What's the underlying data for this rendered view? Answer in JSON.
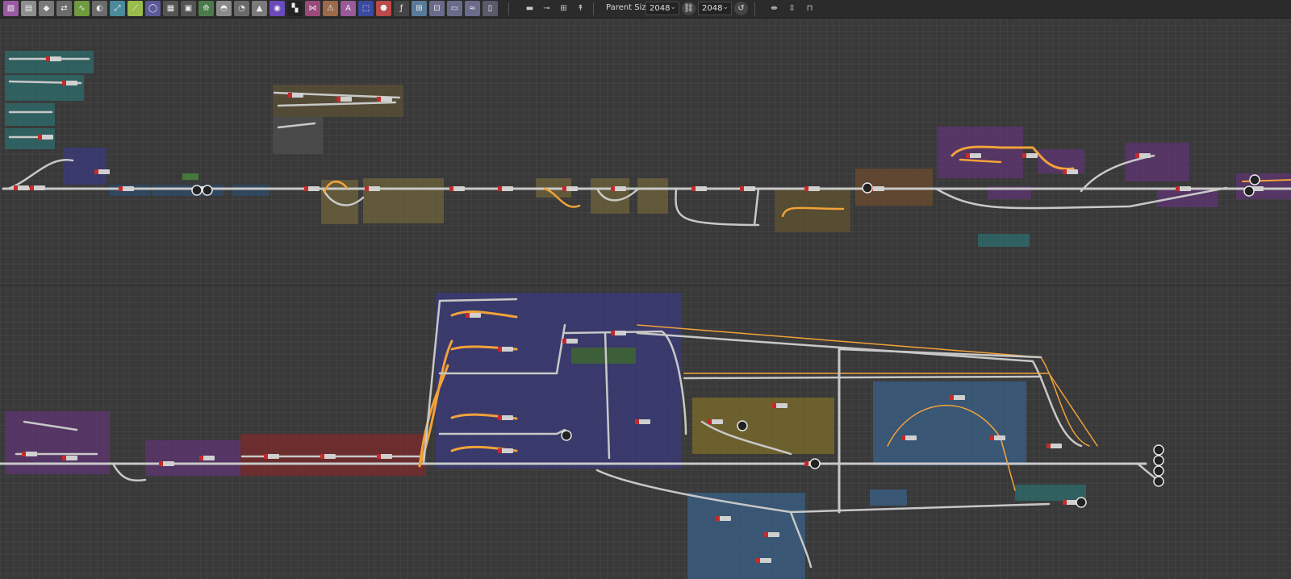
{
  "toolbar": {
    "tools": [
      {
        "name": "image-input-icon",
        "glyph": "▨",
        "color": "#9a5aa2"
      },
      {
        "name": "image-output-icon",
        "glyph": "▤",
        "color": "#8e8e8e"
      },
      {
        "name": "color-fill-icon",
        "glyph": "◆",
        "color": "#7a7a7a"
      },
      {
        "name": "shuffle-icon",
        "glyph": "⇄",
        "color": "#6b6b6b"
      },
      {
        "name": "curve-icon",
        "glyph": "∿",
        "color": "#6f9a3f"
      },
      {
        "name": "blend-icon",
        "glyph": "◐",
        "color": "#6b6b6b"
      },
      {
        "name": "transform-icon",
        "glyph": "⤢",
        "color": "#4a8a9a"
      },
      {
        "name": "levels-icon",
        "glyph": "⟋",
        "color": "#9abc4a"
      },
      {
        "name": "shape-icon",
        "glyph": "◯",
        "color": "#5a5a9a"
      },
      {
        "name": "tile-grid-icon",
        "glyph": "▦",
        "color": "#555555"
      },
      {
        "name": "bitmap-icon",
        "glyph": "▣",
        "color": "#555555"
      },
      {
        "name": "warp-icon",
        "glyph": "⟰",
        "color": "#4a7a4a"
      },
      {
        "name": "gradient-icon",
        "glyph": "◓",
        "color": "#8a8a8a"
      },
      {
        "name": "sharpen-icon",
        "glyph": "◔",
        "color": "#6a6a6a"
      },
      {
        "name": "histogram-icon",
        "glyph": "▲",
        "color": "#7a7a7a"
      },
      {
        "name": "color-wheel-icon",
        "glyph": "◉",
        "color": "#6a4aba"
      },
      {
        "name": "noise-icon",
        "glyph": "▚",
        "color": "#222222"
      },
      {
        "name": "normal-icon",
        "glyph": "⋈",
        "color": "#9a4a7a"
      },
      {
        "name": "warning-shape-icon",
        "glyph": "⚠",
        "color": "#9a6a4a"
      },
      {
        "name": "text-icon",
        "glyph": "A",
        "color": "#9a5a9a"
      },
      {
        "name": "selection-icon",
        "glyph": "⬚",
        "color": "#3a4aa0"
      },
      {
        "name": "paint-bucket-icon",
        "glyph": "⬣",
        "color": "#b84a4a"
      },
      {
        "name": "function-icon",
        "glyph": "ƒ",
        "color": "#444444"
      },
      {
        "name": "pixel-processor-icon",
        "glyph": "⊞",
        "color": "#5a7a9a"
      },
      {
        "name": "fx-map-icon",
        "glyph": "⊡",
        "color": "#6a6a8a"
      },
      {
        "name": "frame-tool-icon",
        "glyph": "▭",
        "color": "#6a6a8a"
      },
      {
        "name": "wave-tool-icon",
        "glyph": "≈",
        "color": "#6a6a8a"
      },
      {
        "name": "panel-icon",
        "glyph": "▯",
        "color": "#5a5a6a"
      }
    ],
    "utilities": [
      {
        "name": "comment-icon",
        "glyph": "▬"
      },
      {
        "name": "pin-icon",
        "glyph": "⊸"
      },
      {
        "name": "layout-icon",
        "glyph": "⊞"
      },
      {
        "name": "dot-icon",
        "glyph": "↟"
      }
    ],
    "parent_size_label": "Parent Size:",
    "parent_size_w": "2048",
    "parent_size_h": "2048",
    "right_tools": [
      {
        "name": "align-horizontal-icon",
        "glyph": "⇼"
      },
      {
        "name": "align-vertical-icon",
        "glyph": "⇳"
      },
      {
        "name": "distribute-icon",
        "glyph": "⊓"
      }
    ]
  },
  "graph": {
    "background": "#393939",
    "frames": [
      {
        "color": "#2e6a6a"
      },
      {
        "color": "#2e6a6a"
      },
      {
        "color": "#2e6a6a"
      },
      {
        "color": "#2e6a6a"
      },
      {
        "color": "#3a3a7a"
      },
      {
        "color": "#5a4f34"
      },
      {
        "color": "#4e4e4e"
      },
      {
        "color": "#6c6138"
      },
      {
        "color": "#6c6138"
      },
      {
        "color": "#6c6138"
      },
      {
        "color": "#6c6138"
      },
      {
        "color": "#6c6138"
      },
      {
        "color": "#5e5230"
      },
      {
        "color": "#2d4a66"
      },
      {
        "color": "#2d4a66"
      },
      {
        "color": "#2d4a66"
      },
      {
        "color": "#6a4a30"
      },
      {
        "color": "#5c3470"
      },
      {
        "color": "#5c3470"
      },
      {
        "color": "#5c3470"
      },
      {
        "color": "#5c3470"
      },
      {
        "color": "#5c3470"
      },
      {
        "color": "#4a8a3a"
      },
      {
        "color": "#5c3470"
      },
      {
        "color": "#5c3470"
      },
      {
        "color": "#5c3470"
      },
      {
        "color": "#7a2a2a"
      },
      {
        "color": "#3a3a7a"
      },
      {
        "color": "#3d6a2d"
      },
      {
        "color": "#7a6a2a"
      },
      {
        "color": "#3a5f85"
      },
      {
        "color": "#3a5f85"
      },
      {
        "color": "#3a5f85"
      },
      {
        "color": "#2e6a6a"
      }
    ]
  }
}
